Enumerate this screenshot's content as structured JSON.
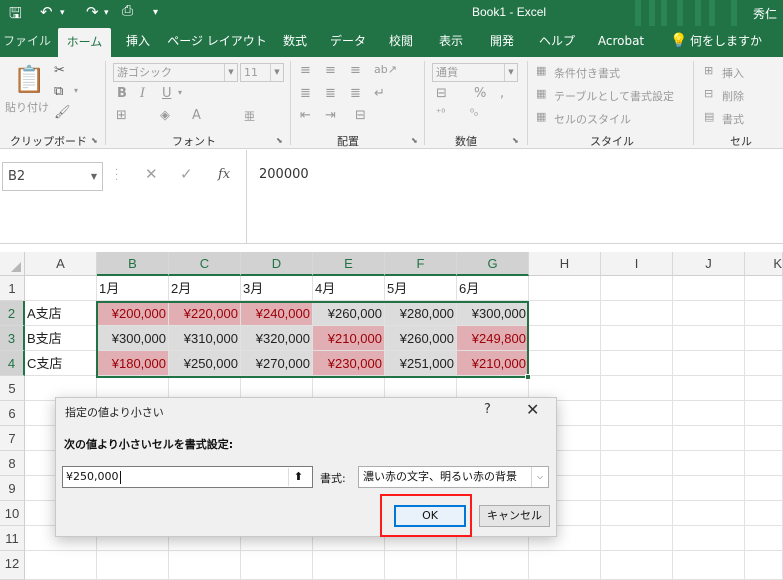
{
  "titlebar": {
    "title": "Book1  -  Excel",
    "user": "秀仁",
    "quick_access": [
      "save-icon",
      "undo-icon",
      "redo-icon",
      "print-preview-icon",
      "customize-icon"
    ]
  },
  "tabs": [
    {
      "label": "ファイル",
      "active": false
    },
    {
      "label": "ホーム",
      "active": true
    },
    {
      "label": "挿入",
      "active": false
    },
    {
      "label": "ページ レイアウト",
      "active": false
    },
    {
      "label": "数式",
      "active": false
    },
    {
      "label": "データ",
      "active": false
    },
    {
      "label": "校閲",
      "active": false
    },
    {
      "label": "表示",
      "active": false
    },
    {
      "label": "開発",
      "active": false
    },
    {
      "label": "ヘルプ",
      "active": false
    },
    {
      "label": "Acrobat",
      "active": false
    },
    {
      "label": "何をしますか",
      "active": false
    }
  ],
  "ribbon": {
    "clipboard": {
      "group": "クリップボード",
      "paste": "貼り付け"
    },
    "font": {
      "group": "フォント",
      "font_name": "游ゴシック",
      "font_size": "11"
    },
    "alignment": {
      "group": "配置"
    },
    "number": {
      "group": "数値",
      "format": "通貨"
    },
    "styles": {
      "group": "スタイル",
      "conditional": "条件付き書式",
      "table": "テーブルとして書式設定",
      "cell_styles": "セルのスタイル"
    },
    "cells": {
      "group": "セル",
      "insert": "挿入",
      "delete": "削除",
      "format": "書式"
    }
  },
  "formula_bar": {
    "name_box": "B2",
    "cancel": "✕",
    "enter": "✓",
    "fx": "fx",
    "value": "200000"
  },
  "sheet": {
    "columns": [
      "A",
      "B",
      "C",
      "D",
      "E",
      "F",
      "G",
      "H",
      "I",
      "J",
      "K"
    ],
    "rows": [
      "1",
      "2",
      "3",
      "4",
      "5",
      "6",
      "7",
      "8",
      "9",
      "10",
      "11",
      "12"
    ],
    "header_row": [
      "",
      "1月",
      "2月",
      "3月",
      "4月",
      "5月",
      "6月"
    ],
    "data_rows": [
      {
        "label": "A支店",
        "values": [
          "¥200,000",
          "¥220,000",
          "¥240,000",
          "¥260,000",
          "¥280,000",
          "¥300,000"
        ],
        "highlight": [
          true,
          true,
          true,
          false,
          false,
          false
        ]
      },
      {
        "label": "B支店",
        "values": [
          "¥300,000",
          "¥310,000",
          "¥320,000",
          "¥210,000",
          "¥260,000",
          "¥249,800"
        ],
        "highlight": [
          false,
          false,
          false,
          true,
          false,
          true
        ]
      },
      {
        "label": "C支店",
        "values": [
          "¥180,000",
          "¥250,000",
          "¥270,000",
          "¥230,000",
          "¥251,000",
          "¥210,000"
        ],
        "highlight": [
          true,
          false,
          false,
          true,
          false,
          true
        ]
      }
    ],
    "highlight_bg": "#ffc7ce",
    "highlight_text": "#9c0006"
  },
  "dialog": {
    "title": "指定の値より小さい",
    "help": "?",
    "close": "✕",
    "prompt": "次の値より小さいセルを書式設定:",
    "value": "¥250,000",
    "format_label": "書式:",
    "format_value": "濃い赤の文字、明るい赤の背景",
    "ok": "OK",
    "cancel": "キャンセル"
  },
  "colors": {
    "excel_green": "#217346",
    "annotation_red": "#ff1a1a"
  }
}
